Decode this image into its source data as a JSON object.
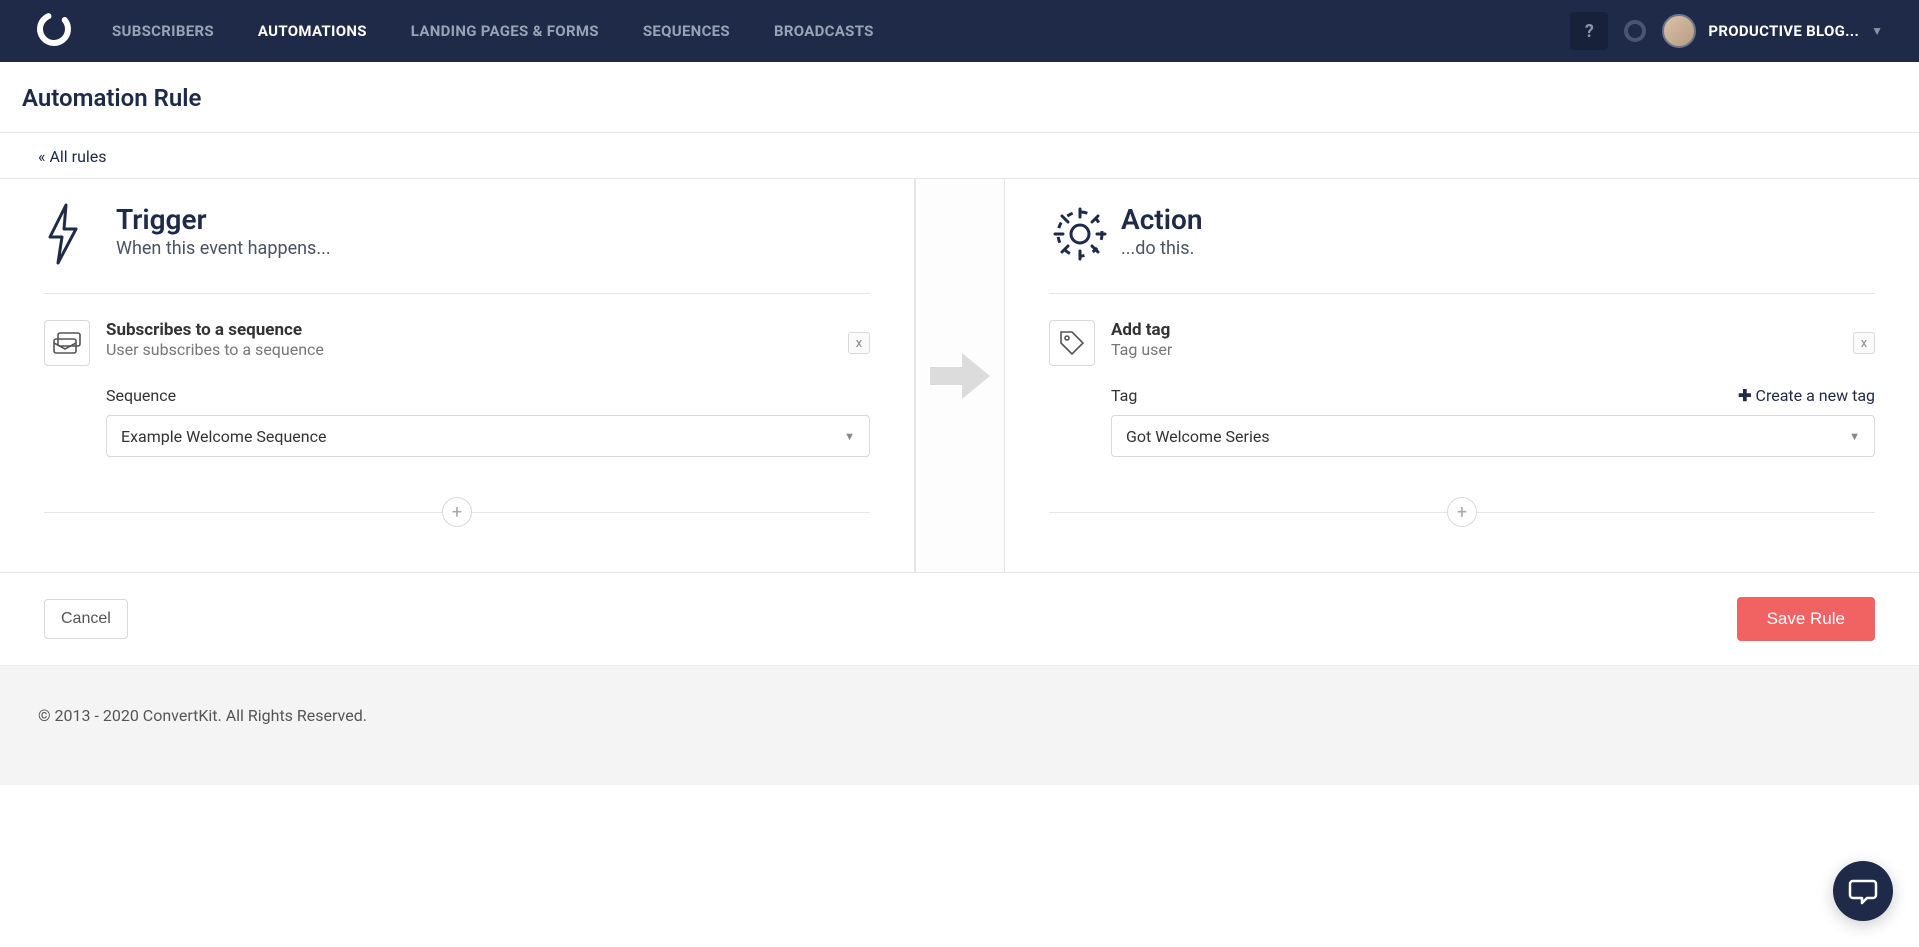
{
  "nav": {
    "items": [
      {
        "label": "SUBSCRIBERS",
        "active": false
      },
      {
        "label": "AUTOMATIONS",
        "active": true
      },
      {
        "label": "LANDING PAGES & FORMS",
        "active": false
      },
      {
        "label": "SEQUENCES",
        "active": false
      },
      {
        "label": "BROADCASTS",
        "active": false
      }
    ],
    "help": "?",
    "user": "PRODUCTIVE BLOG..."
  },
  "page": {
    "title": "Automation Rule",
    "breadcrumb": "« All rules"
  },
  "trigger": {
    "heading": "Trigger",
    "subheading": "When this event happens...",
    "card_title": "Subscribes to a sequence",
    "card_sub": "User subscribes to a sequence",
    "field_label": "Sequence",
    "field_value": "Example Welcome Sequence",
    "remove": "x"
  },
  "action": {
    "heading": "Action",
    "subheading": "...do this.",
    "card_title": "Add tag",
    "card_sub": "Tag user",
    "field_label": "Tag",
    "create_label": "Create a new tag",
    "field_value": "Got Welcome Series",
    "remove": "x"
  },
  "buttons": {
    "cancel": "Cancel",
    "save": "Save Rule",
    "add": "+"
  },
  "footer": {
    "copyright": "© 2013 - 2020 ConvertKit. All Rights Reserved."
  }
}
